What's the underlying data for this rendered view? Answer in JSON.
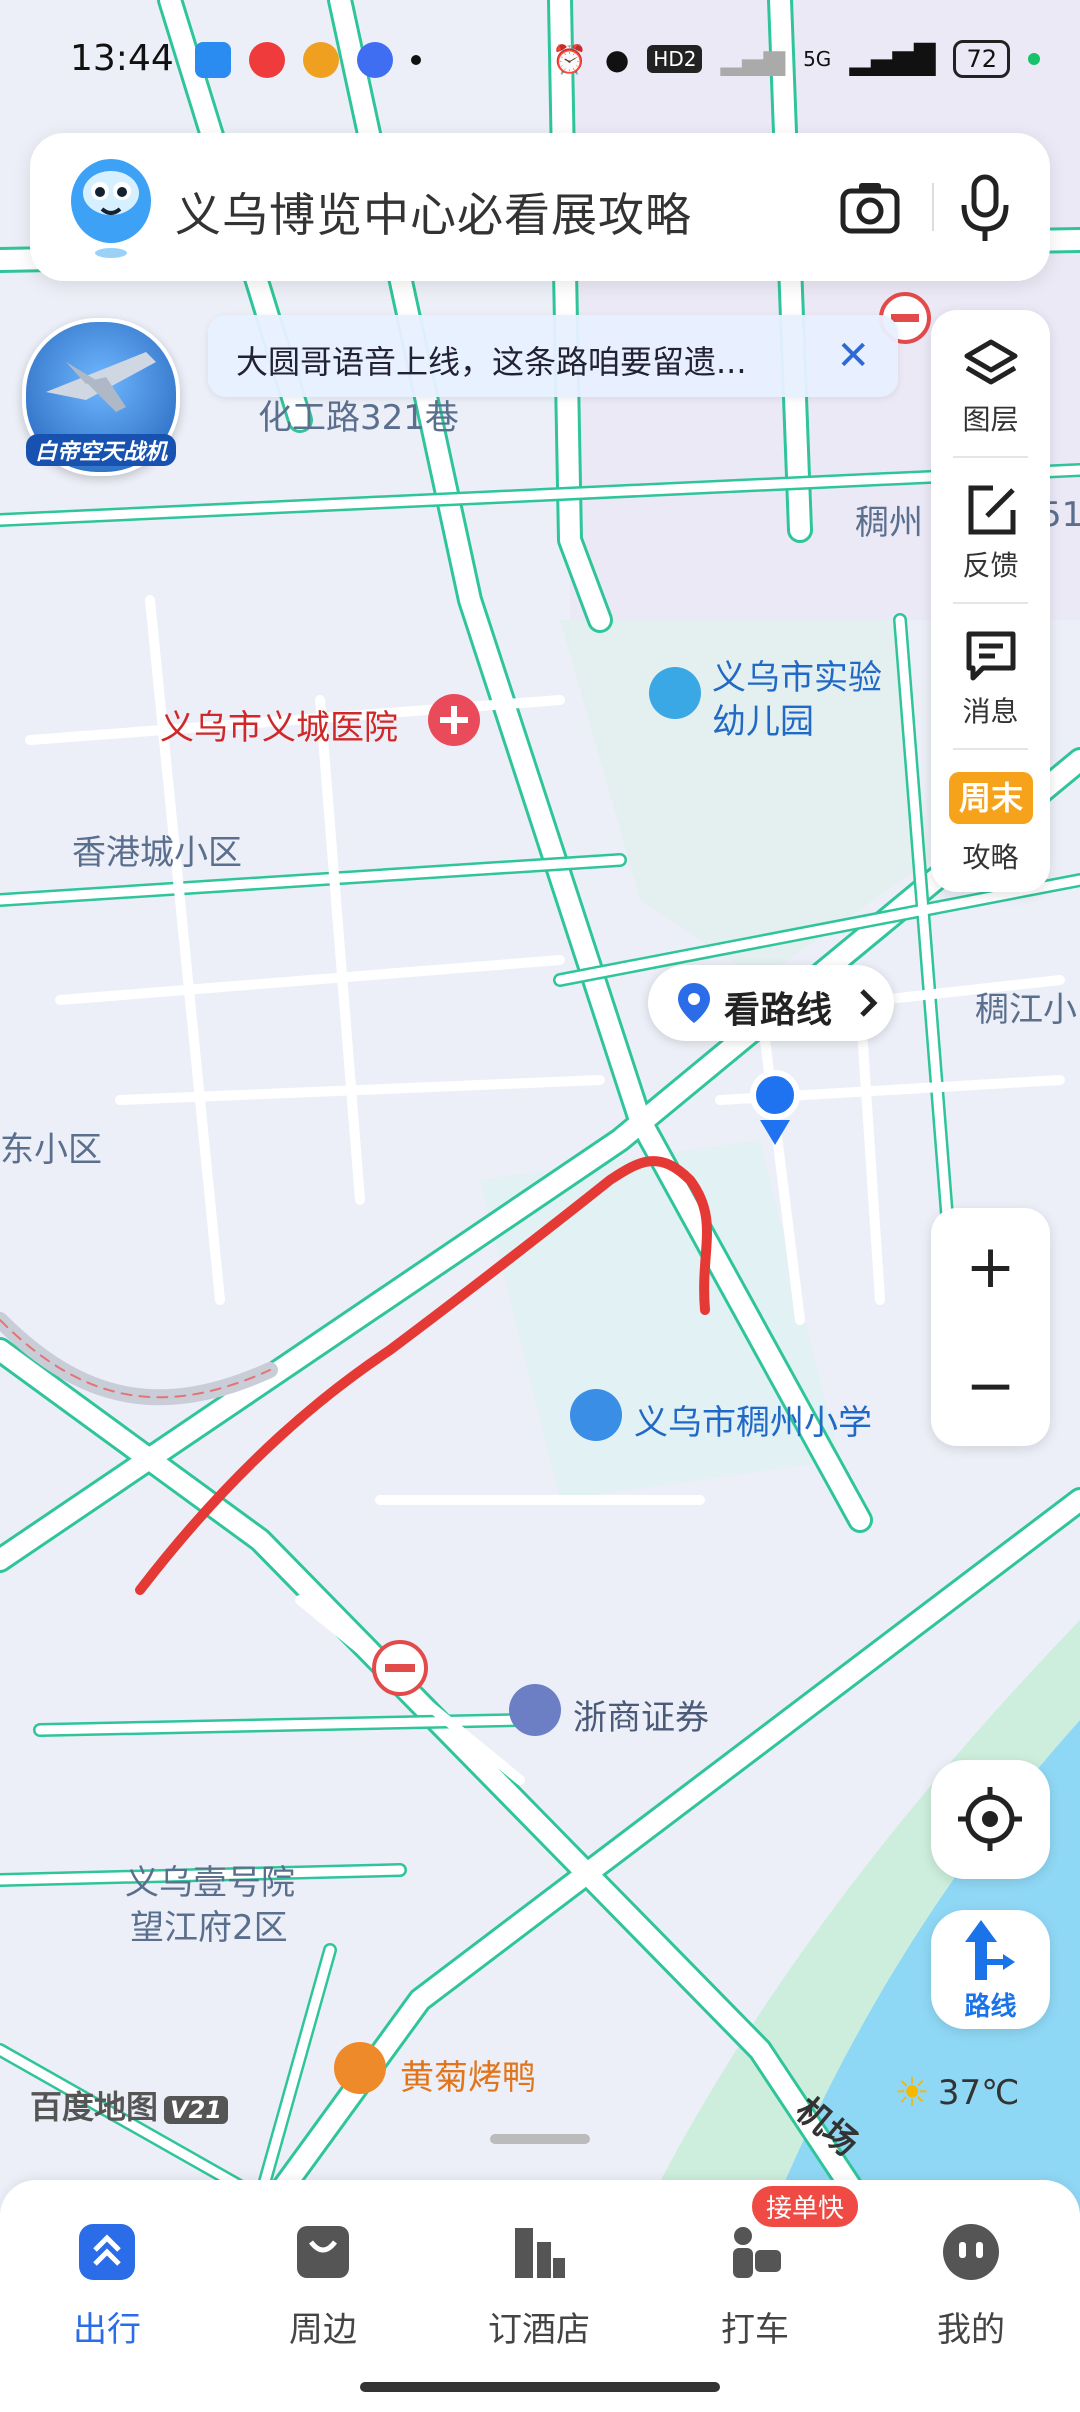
{
  "status_bar": {
    "time": "13:44",
    "hd_label": "HD2",
    "network_label": "5G",
    "battery": "72"
  },
  "search": {
    "query": "义乌博览中心必看展攻略"
  },
  "promo": {
    "label": "白帝空天战机"
  },
  "notice": {
    "text": "大圆哥语音上线，这条路咱要留遗...",
    "close_glyph": "✕"
  },
  "side_panel": {
    "items": [
      {
        "label": "图层",
        "icon": "layers-icon"
      },
      {
        "label": "反馈",
        "icon": "edit-icon"
      },
      {
        "label": "消息",
        "icon": "message-icon"
      },
      {
        "label": "攻略",
        "icon": "weekend-icon",
        "badge": "周末"
      }
    ]
  },
  "map": {
    "labels": {
      "road_partial": "化工路321巷",
      "area_chouzhou": "稠州",
      "area_chouzhou_num": "51",
      "kindergarten_line1": "义乌市实验",
      "kindergarten_line2": "幼儿园",
      "hospital": "义乌市义城医院",
      "xianggang": "香港城小区",
      "east_area": "东小区",
      "chou_jiang": "稠江小",
      "school": "义乌市稠州小学",
      "securities": "浙商证券",
      "residence_line1": "义乌壹号院",
      "residence_line2": "望江府2区",
      "roast_duck": "黄菊烤鸭",
      "airport_road": "机场"
    }
  },
  "route_chip": {
    "label": "看路线"
  },
  "controls": {
    "zoom_in": "+",
    "zoom_out": "−",
    "route_label": "路线"
  },
  "weather": {
    "temp": "37℃"
  },
  "brand": {
    "name": "百度地图",
    "version": "V21"
  },
  "tabbar": {
    "badge": "接单快",
    "tabs": [
      {
        "label": "出行",
        "active": true
      },
      {
        "label": "周边"
      },
      {
        "label": "订酒店"
      },
      {
        "label": "打车"
      },
      {
        "label": "我的"
      }
    ]
  },
  "colors": {
    "accent": "#2b6de8",
    "road_outline": "#2fc59a",
    "river": "#8fd8f5",
    "route_red": "#e53935"
  }
}
